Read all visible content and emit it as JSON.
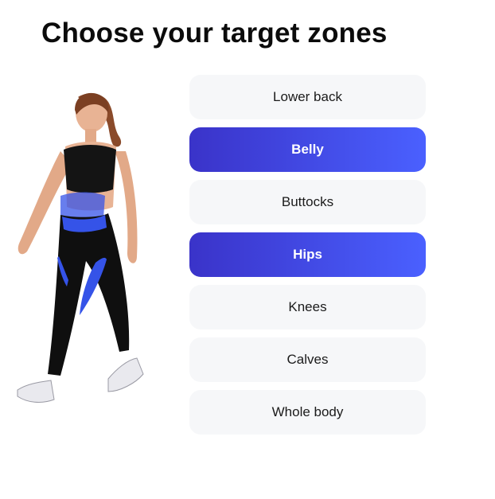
{
  "header": {
    "title": "Choose your target zones"
  },
  "illustration": {
    "subject": "woman-walking",
    "highlight_color": "#3553e8"
  },
  "zones": [
    {
      "label": "Lower back",
      "selected": false
    },
    {
      "label": "Belly",
      "selected": true
    },
    {
      "label": "Buttocks",
      "selected": false
    },
    {
      "label": "Hips",
      "selected": true
    },
    {
      "label": "Knees",
      "selected": false
    },
    {
      "label": "Calves",
      "selected": false
    },
    {
      "label": "Whole body",
      "selected": false
    }
  ],
  "colors": {
    "selected_start": "#3a33c9",
    "selected_end": "#4a60ff",
    "unselected_bg": "#f6f7f9",
    "title_text": "#0b0b0b"
  }
}
